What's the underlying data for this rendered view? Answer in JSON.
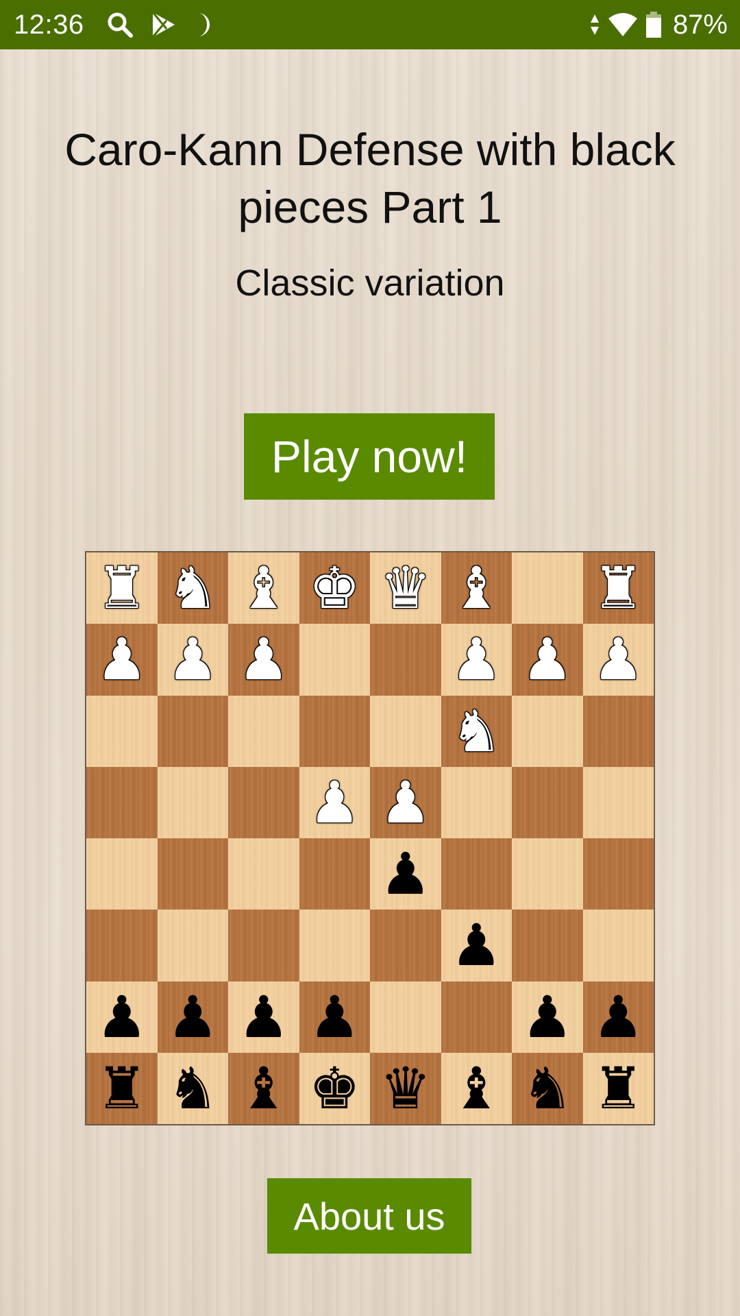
{
  "status_bar": {
    "time": "12:36",
    "left_icons": [
      "search-icon",
      "play-store-icon",
      "do-not-disturb-moon-icon"
    ],
    "right_icons": [
      "data-transfer-arrows-icon",
      "wifi-icon",
      "battery-icon"
    ],
    "battery_percent": "87%",
    "background_color": "#4a6e00"
  },
  "header": {
    "title": "Caro-Kann Defense with black pieces Part 1",
    "subtitle": "Classic variation"
  },
  "buttons": {
    "play_now": "Play now!",
    "about_us": "About us",
    "color": "#5a8a00"
  },
  "board": {
    "orientation": "black-at-bottom",
    "light_square_color": "#f2cf9e",
    "dark_square_color": "#b8743f",
    "rows": [
      [
        "wR",
        "wN",
        "wB",
        "wK",
        "wQ",
        "wB",
        "",
        "wR"
      ],
      [
        "wP",
        "wP",
        "wP",
        "",
        "",
        "wP",
        "wP",
        "wP"
      ],
      [
        "",
        "",
        "",
        "",
        "",
        "wN",
        "",
        ""
      ],
      [
        "",
        "",
        "",
        "wP",
        "wP",
        "",
        "",
        ""
      ],
      [
        "",
        "",
        "",
        "",
        "bP",
        "",
        "",
        ""
      ],
      [
        "",
        "",
        "",
        "",
        "",
        "bP",
        "",
        ""
      ],
      [
        "bP",
        "bP",
        "bP",
        "bP",
        "",
        "",
        "bP",
        "bP"
      ],
      [
        "bR",
        "bN",
        "bB",
        "bK",
        "bQ",
        "bB",
        "bN",
        "bR"
      ]
    ]
  }
}
